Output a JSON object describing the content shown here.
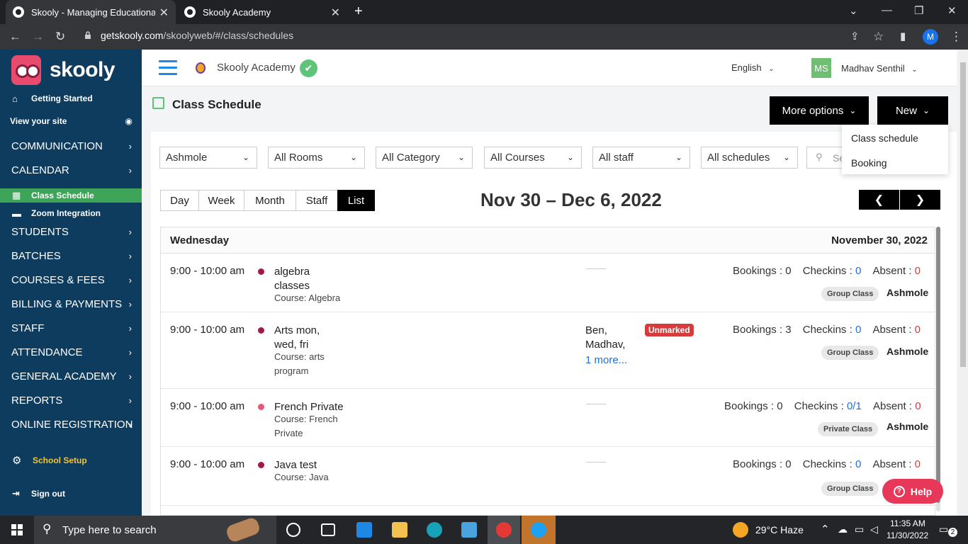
{
  "browser": {
    "tabs": [
      {
        "title": "Skooly - Managing Educational Ir",
        "active": true
      },
      {
        "title": "Skooly Academy",
        "active": false
      }
    ],
    "url_host": "getskooly.com",
    "url_path": "/skoolyweb/#/class/schedules",
    "profile_initial": "M"
  },
  "sidebar": {
    "logo_text": "skooly",
    "getting_started": "Getting Started",
    "view_site": "View your site",
    "items": [
      {
        "label": "COMMUNICATION"
      },
      {
        "label": "CALENDAR"
      }
    ],
    "calendar_sub": [
      {
        "label": "Class Schedule",
        "active": true
      },
      {
        "label": "Zoom Integration",
        "active": false
      }
    ],
    "items2": [
      {
        "label": "STUDENTS"
      },
      {
        "label": "BATCHES"
      },
      {
        "label": "COURSES & FEES"
      },
      {
        "label": "BILLING & PAYMENTS"
      },
      {
        "label": "STAFF"
      },
      {
        "label": "ATTENDANCE"
      },
      {
        "label": "GENERAL ACADEMY"
      },
      {
        "label": "REPORTS"
      },
      {
        "label": "ONLINE REGISTRATION"
      }
    ],
    "school_setup": "School Setup",
    "sign_out": "Sign out"
  },
  "header": {
    "academy_name": "Skooly Academy",
    "language": "English",
    "avatar_initials": "MS",
    "user_name": "Madhav Senthil"
  },
  "page": {
    "title": "Class Schedule",
    "more_options": "More options",
    "new_button": "New",
    "new_menu": [
      "Class schedule",
      "Booking"
    ],
    "filters": [
      "Ashmole",
      "All Rooms",
      "All Category",
      "All Courses",
      "All staff",
      "All schedules"
    ],
    "search_placeholder": "Se",
    "views": [
      "Day",
      "Week",
      "Month",
      "Staff",
      "List"
    ],
    "selected_view": "List",
    "date_range": "Nov 30 – Dec 6, 2022"
  },
  "schedule": {
    "day": "Wednesday",
    "date": "November 30, 2022",
    "stat_labels": {
      "bookings": "Bookings :",
      "checkins": "Checkins :",
      "absent": "Absent :"
    },
    "rows": [
      {
        "time": "9:00 - 10:00 am",
        "name": "algebra classes",
        "course": "Course: Algebra",
        "dot_color": "#a3174a",
        "staff": "",
        "more": "",
        "status": "",
        "bookings": "0",
        "checkins": "0",
        "absent": "0",
        "type": "Group Class",
        "location": "Ashmole"
      },
      {
        "time": "9:00 - 10:00 am",
        "name": "Arts mon, wed, fri",
        "course": "Course: arts program",
        "dot_color": "#a3174a",
        "staff": "Ben, Madhav,",
        "more": "1 more...",
        "status": "Unmarked",
        "bookings": "3",
        "checkins": "0",
        "absent": "0",
        "type": "Group Class",
        "location": "Ashmole"
      },
      {
        "time": "9:00 - 10:00 am",
        "name": "French Private",
        "course": "Course: French Private",
        "dot_color": "#e5587a",
        "staff": "",
        "more": "",
        "status": "",
        "bookings": "0",
        "checkins": "0/1",
        "absent": "0",
        "type": "Private Class",
        "location": "Ashmole"
      },
      {
        "time": "9:00 - 10:00 am",
        "name": "Java test",
        "course": "Course: Java",
        "dot_color": "#a3174a",
        "staff": "",
        "more": "",
        "status": "",
        "bookings": "0",
        "checkins": "0",
        "absent": "0",
        "type": "Group Class",
        "location": ""
      }
    ]
  },
  "help_label": "Help",
  "taskbar": {
    "search_placeholder": "Type here to search",
    "weather": "29°C  Haze",
    "time": "11:35 AM",
    "date": "11/30/2022",
    "notification_count": "2"
  }
}
